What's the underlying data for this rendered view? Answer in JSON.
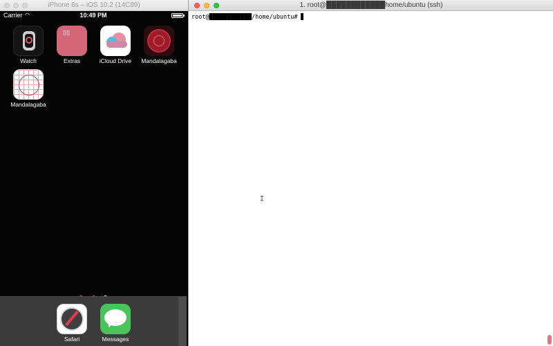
{
  "simulator": {
    "title": "iPhone 6s – iOS 10.2 (14C89)",
    "statusbar": {
      "carrier": "Carrier",
      "time": "10:49 PM"
    },
    "apps": [
      {
        "label": "Watch"
      },
      {
        "label": "Extras"
      },
      {
        "label": "iCloud Drive"
      },
      {
        "label": "Mandalagaba"
      },
      {
        "label": "Mandalagaba"
      }
    ],
    "page_indicator": {
      "count": 3,
      "active_index": 2
    },
    "dock": [
      {
        "label": "Safari"
      },
      {
        "label": "Messages"
      }
    ]
  },
  "terminal": {
    "title": "1. root@████████████home/ubuntu (ssh)",
    "prompt": "root@████████████/home/ubuntu#"
  },
  "colors": {
    "close": "#fc605c",
    "minimize": "#fdbc40",
    "maximize": "#34c84a",
    "page_dot": "#c45c6c",
    "dock": "#3b3b3b"
  }
}
